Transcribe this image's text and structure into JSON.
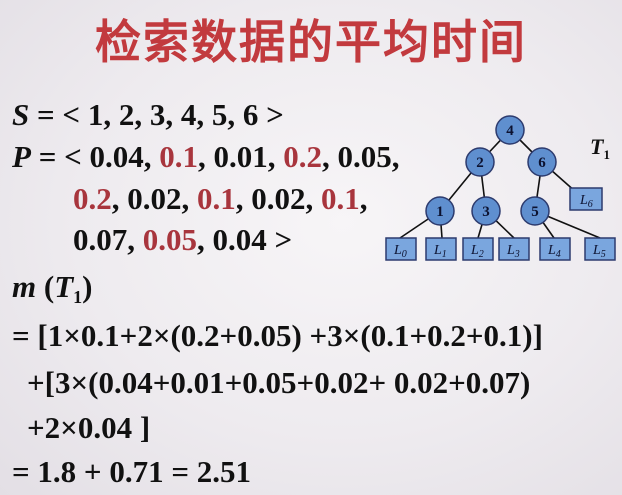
{
  "title": "检索数据的平均时间",
  "s_line": {
    "var": "S",
    "rest": " = < 1, 2, 3, 4, 5, 6 >"
  },
  "p_line1": {
    "var": "P",
    "a": " = < 0.04, ",
    "b": "0.1",
    "c": ", 0.01, ",
    "d": "0.2",
    "e": ", 0.05,"
  },
  "p_line2": {
    "a": "0.2",
    "b": ", 0.02, ",
    "c": "0.1",
    "d": ", 0.02, ",
    "e": "0.1",
    "f": ","
  },
  "p_line3": {
    "a": "0.07, ",
    "b": "0.05",
    "c": ", 0.04 >"
  },
  "m_line": {
    "m": "m",
    "open": " (",
    "t": "T",
    "sub": "1",
    "close": ")"
  },
  "calc1": "= [1×0.1+2×(0.2+0.05) +3×(0.1+0.2+0.1)]",
  "calc2": "+[3×(0.04+0.01+0.05+0.02+ 0.02+0.07)",
  "calc3": "+2×0.04 ]",
  "result": "= 1.8 + 0.71 = 2.51",
  "tree": {
    "label": "T",
    "label_sub": "1",
    "nodes": [
      "4",
      "2",
      "6",
      "1",
      "3",
      "5"
    ],
    "leaves": [
      "0",
      "1",
      "2",
      "3",
      "4",
      "5",
      "6"
    ],
    "leaf_prefix": "L"
  }
}
